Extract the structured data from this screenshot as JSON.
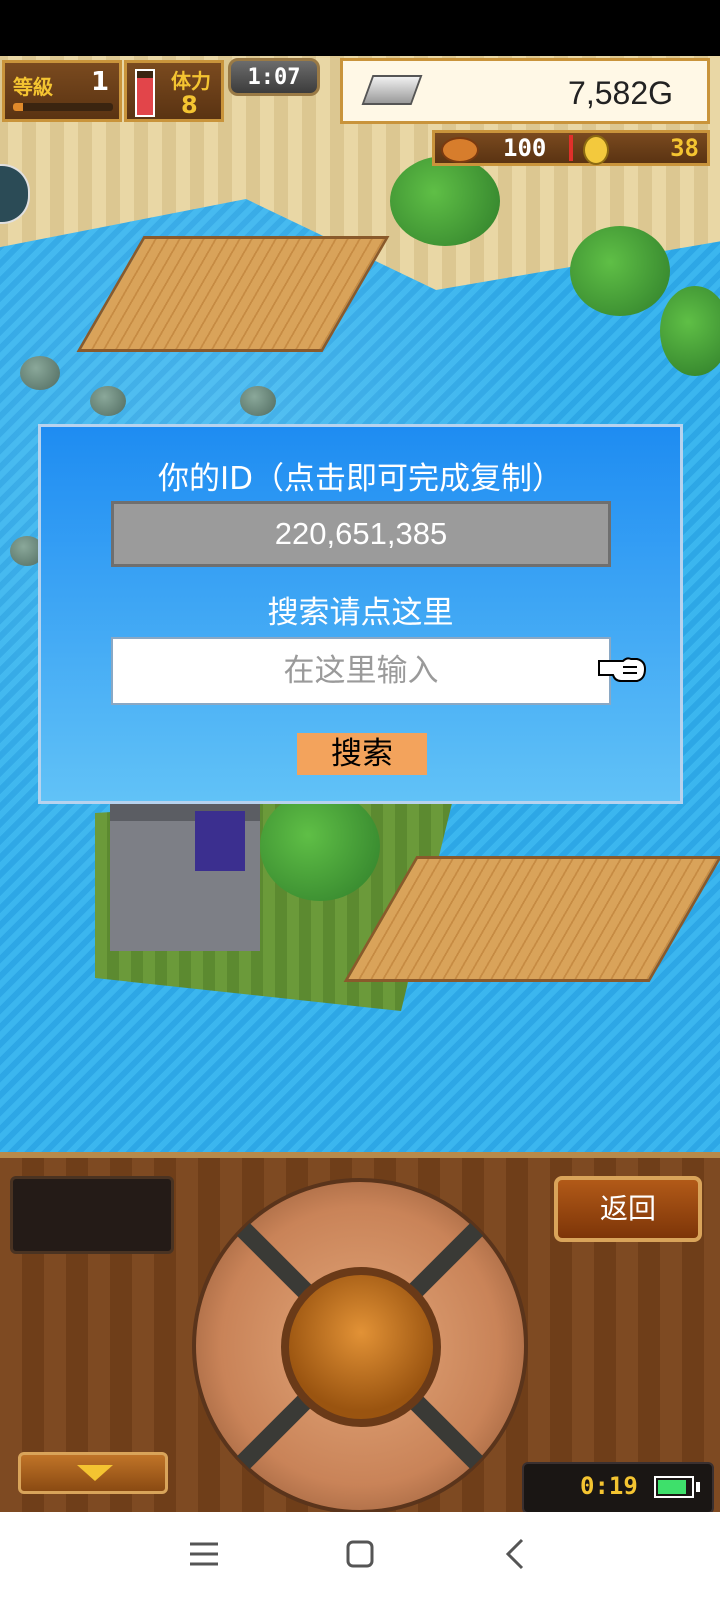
{
  "hud": {
    "level_label": "等級",
    "level_value": "1",
    "level_progress": 0.1,
    "stamina_label": "体力",
    "stamina_value": "8",
    "stamina_fill": 0.85,
    "timer": "1:07",
    "gold": "7,582G",
    "food_value": "100",
    "coin_value": "38"
  },
  "dialog": {
    "title": "你的ID（点击即可完成复制）",
    "id_value": "220,651,385",
    "search_hint": "搜索请点这里",
    "input_placeholder": "在这里输入",
    "search_button": "搜索"
  },
  "controller": {
    "back_button": "返回",
    "clock": "0:19",
    "battery_level": 0.9
  },
  "colors": {
    "dialog_top": "#1e8cf2",
    "dialog_bottom": "#61c2f7",
    "search_button": "#f3a35c",
    "gold_text": "#f4c431",
    "water": "#2da7e6"
  },
  "icons": {
    "gold_bar": "gold-bar-icon",
    "food": "meat-icon",
    "coin": "coin-icon",
    "pointer": "pointing-hand-icon",
    "down_arrow": "arrow-down-icon",
    "battery": "battery-icon",
    "nav_menu": "menu-icon",
    "nav_home": "home-icon",
    "nav_back": "back-icon"
  }
}
